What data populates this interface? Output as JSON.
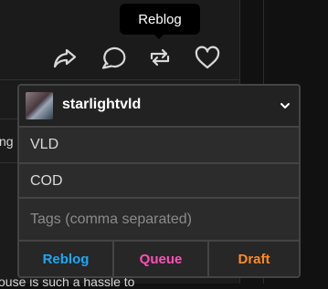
{
  "tooltip": {
    "label": "Reblog"
  },
  "background": {
    "left_snippet": "ng",
    "bottom_snippet": "ouse is such a hassle to"
  },
  "actions": [
    {
      "name": "share",
      "icon": "share-icon"
    },
    {
      "name": "reply",
      "icon": "chat-bubble-icon"
    },
    {
      "name": "reblog",
      "icon": "reblog-icon"
    },
    {
      "name": "like",
      "icon": "heart-outline-icon"
    }
  ],
  "reblog_panel": {
    "blog": {
      "name": "starlightvld",
      "avatar_icon": "blog-avatar",
      "dropdown_icon": "chevron-down-icon"
    },
    "tags": [
      "VLD",
      "COD"
    ],
    "tags_input": {
      "value": "",
      "placeholder": "Tags (comma separated)"
    },
    "buttons": {
      "reblog": {
        "label": "Reblog",
        "color": "#1ea7f6"
      },
      "queue": {
        "label": "Queue",
        "color": "#ff4fb8"
      },
      "draft": {
        "label": "Draft",
        "color": "#ff8a26"
      }
    }
  },
  "colors": {
    "panel_bg": "#2b2b2b",
    "panel_border": "#444444",
    "page_bg": "#111111",
    "card_bg": "#1b1b1b"
  }
}
